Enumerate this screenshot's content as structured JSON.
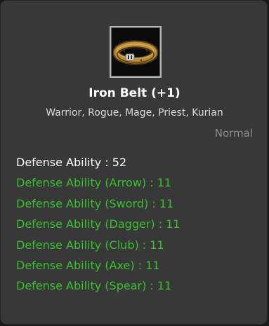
{
  "item": {
    "name": "Iron Belt (+1)",
    "classes": "Warrior, Rogue, Mage, Priest, Kurian",
    "grade": "Normal",
    "icon": "belt-icon"
  },
  "stats": [
    {
      "text": "Defense Ability : 52",
      "color": "#ffffff"
    },
    {
      "text": "Defense Ability (Arrow) : 11",
      "color": "#36c12d"
    },
    {
      "text": "Defense Ability (Sword) : 11",
      "color": "#36c12d"
    },
    {
      "text": "Defense Ability (Dagger) : 11",
      "color": "#36c12d"
    },
    {
      "text": "Defense Ability (Club) : 11",
      "color": "#36c12d"
    },
    {
      "text": "Defense Ability (Axe) : 11",
      "color": "#36c12d"
    },
    {
      "text": "Defense Ability (Spear) : 11",
      "color": "#36c12d"
    }
  ]
}
